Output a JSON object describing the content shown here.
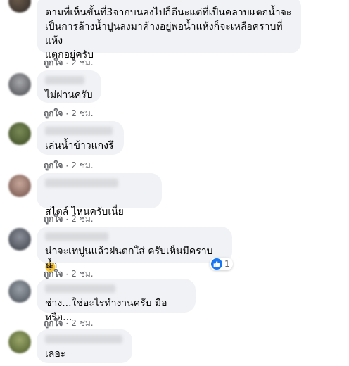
{
  "comments": [
    {
      "text": "ตามที่เห็นขั้นที่3จากบนลงไปก็ดีนะแต่ที่เป็นคลาบแตกน้ำจะ\nเป็นการล้างน้ำปูนลงมาค้างอยู่พอน้ำแห้งก็จะเหลือคราบที่แห้ง\nแตกอยู่ครับ",
      "like_label": "ถูกใจ",
      "time": "2 ชม."
    },
    {
      "text": "ไม่ผ่านครับ",
      "like_label": "ถูกใจ",
      "time": "2 ชม."
    },
    {
      "text": "เล่นน้ำข้าวแกงรึ",
      "like_label": "ถูกใจ",
      "time": "2 ชม."
    },
    {
      "text": "สไตล์ ไหนครับเนี่ย",
      "like_label": "ถูกใจ",
      "time": "2 ชม."
    },
    {
      "text": "น่าจะเทปูนแล้วฝนตกใส่ ครับเห็นมีคราบน้ำ",
      "like_label": "ถูกใจ",
      "time": "2 ชม.",
      "reaction_count": "1"
    },
    {
      "text": "ช่าง...ใช่อะไรทำงานครับ มือหรือ...",
      "like_label": "ถูกใจ",
      "time": "2 ชม."
    },
    {
      "text": "เลอะ"
    }
  ],
  "icons": {
    "like_reaction": "thumbs-up-icon",
    "emoji": "grinning-face-icon"
  },
  "colors": {
    "bubble": "#f0f2f5",
    "meta_text": "#65676b",
    "like_blue": "#1877f2"
  }
}
